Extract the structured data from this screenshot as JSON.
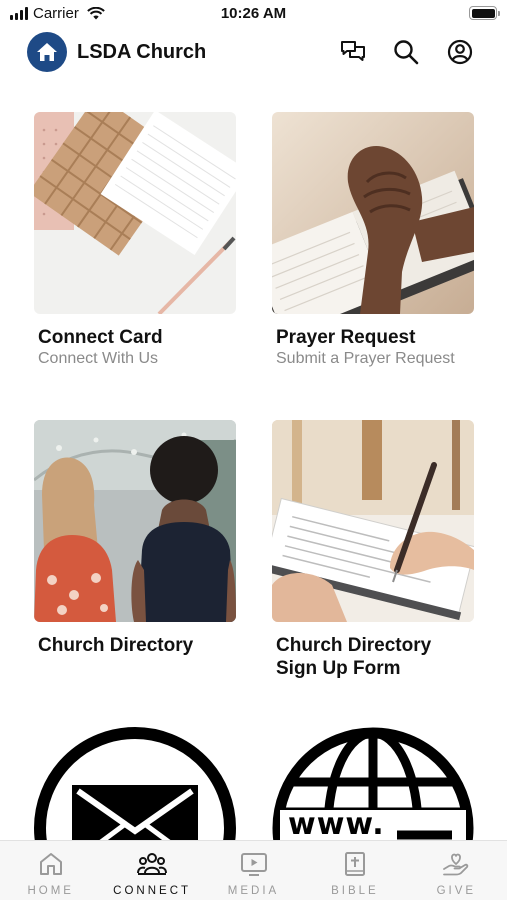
{
  "status_bar": {
    "carrier": "Carrier",
    "time": "10:26 AM"
  },
  "header": {
    "title": "LSDA Church"
  },
  "tiles": [
    {
      "title": "Connect Card",
      "subtitle": "Connect With Us"
    },
    {
      "title": "Prayer Request",
      "subtitle": "Submit a Prayer Request"
    },
    {
      "title": "Church Directory"
    },
    {
      "title": "Church Directory",
      "title2": "Sign Up Form"
    },
    {
      "icon": "envelope-icon"
    },
    {
      "icon": "www-globe-icon",
      "text": "www."
    }
  ],
  "tabbar": {
    "active": "CONNECT",
    "tabs": [
      {
        "label": "HOME",
        "icon": "home-icon"
      },
      {
        "label": "CONNECT",
        "icon": "people-icon"
      },
      {
        "label": "MEDIA",
        "icon": "tv-play-icon"
      },
      {
        "label": "BIBLE",
        "icon": "bible-icon"
      },
      {
        "label": "GIVE",
        "icon": "heart-hand-icon"
      }
    ]
  },
  "colors": {
    "brand": "#1e4a86",
    "active_tab": "#111111",
    "inactive_tab": "#9a9a9a",
    "subtitle": "#8a8a8a"
  }
}
